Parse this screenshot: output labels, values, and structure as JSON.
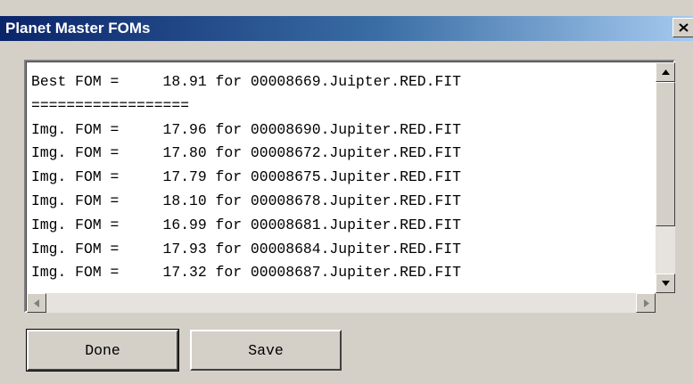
{
  "window": {
    "title": "Planet Master FOMs"
  },
  "lines": [
    "Best FOM =     18.91 for 00008669.Juipter.RED.FIT",
    "==================",
    "Img. FOM =     17.96 for 00008690.Jupiter.RED.FIT",
    "Img. FOM =     17.80 for 00008672.Jupiter.RED.FIT",
    "Img. FOM =     17.79 for 00008675.Jupiter.RED.FIT",
    "Img. FOM =     18.10 for 00008678.Jupiter.RED.FIT",
    "Img. FOM =     16.99 for 00008681.Jupiter.RED.FIT",
    "Img. FOM =     17.93 for 00008684.Jupiter.RED.FIT",
    "Img. FOM =     17.32 for 00008687.Jupiter.RED.FIT"
  ],
  "buttons": {
    "done": "Done",
    "save": "Save"
  },
  "icons": {
    "close": "close-icon",
    "up": "arrow-up-icon",
    "down": "arrow-down-icon",
    "left": "arrow-left-icon",
    "right": "arrow-right-icon"
  },
  "colors": {
    "titlebar_start": "#0a246a",
    "titlebar_end": "#a6caf0",
    "face": "#d4d0c8"
  }
}
